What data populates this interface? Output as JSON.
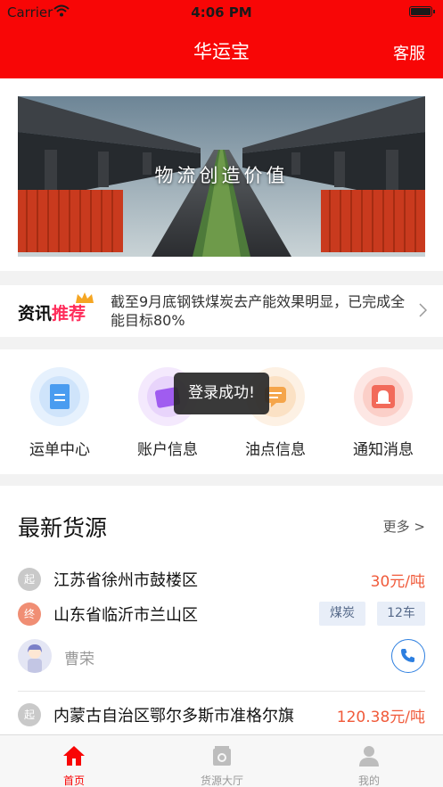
{
  "status_bar": {
    "carrier": "Carrier",
    "time": "4:06 PM"
  },
  "navbar": {
    "title": "华运宝",
    "service_label": "客服"
  },
  "banner": {
    "slogan": "物流创造价值"
  },
  "news": {
    "label_main": "资讯",
    "label_accent": "推荐",
    "text": "截至9月底钢铁煤炭去产能效果明显，已完成全能目标80%"
  },
  "shortcuts": [
    {
      "label": "运单中心",
      "icon": "waybill-icon",
      "color": "#4a9cf0"
    },
    {
      "label": "账户信息",
      "icon": "wallet-icon",
      "color": "#a05cf0"
    },
    {
      "label": "油点信息",
      "icon": "message-icon",
      "color": "#f5a54a"
    },
    {
      "label": "通知消息",
      "icon": "bell-icon",
      "color": "#f26a5a"
    }
  ],
  "toast": "登录成功!",
  "sources": {
    "title": "最新货源",
    "more": "更多 >",
    "start_mark": "起",
    "end_mark": "终",
    "item1": {
      "from": "江苏省徐州市鼓楼区",
      "to": "山东省临沂市兰山区",
      "price": "30元/吨",
      "tags": [
        "煤炭",
        "12车"
      ],
      "person": "曹荣"
    },
    "item2": {
      "from": "内蒙古自治区鄂尔多斯市准格尔旗",
      "price": "120.38元/吨"
    }
  },
  "tabbar": [
    {
      "label": "首页",
      "active": true
    },
    {
      "label": "货源大厅",
      "active": false
    },
    {
      "label": "我的",
      "active": false
    }
  ],
  "colors": {
    "brand_red": "#f80606",
    "price": "#f05a3a",
    "accent_pink": "#ff2c5a"
  }
}
